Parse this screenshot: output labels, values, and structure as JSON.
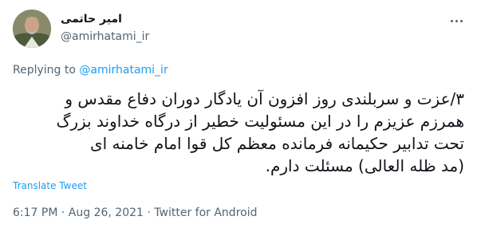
{
  "author": {
    "name": "امیر حاتمی",
    "handle": "@amirhatami_ir"
  },
  "reply": {
    "prefix": "Replying to ",
    "to": "@amirhatami_ir"
  },
  "tweet": {
    "lines": [
      "۳/عزت و سربلندی روز افزون آن یادگار دوران دفاع مقدس و",
      "همرزم عزیزم را در این مسئولیت خطیر از درگاه خداوند بزرگ",
      "تحت تدابیر حکیمانه فرمانده معظم کل قوا امام خامنه ای",
      "(مد ظله العالی) مسئلت دارم."
    ]
  },
  "translate_label": "Translate Tweet",
  "meta": {
    "time": "6:17 PM",
    "sep1": " · ",
    "date": "Aug 26, 2021",
    "sep2": " · ",
    "source": "Twitter for Android"
  }
}
